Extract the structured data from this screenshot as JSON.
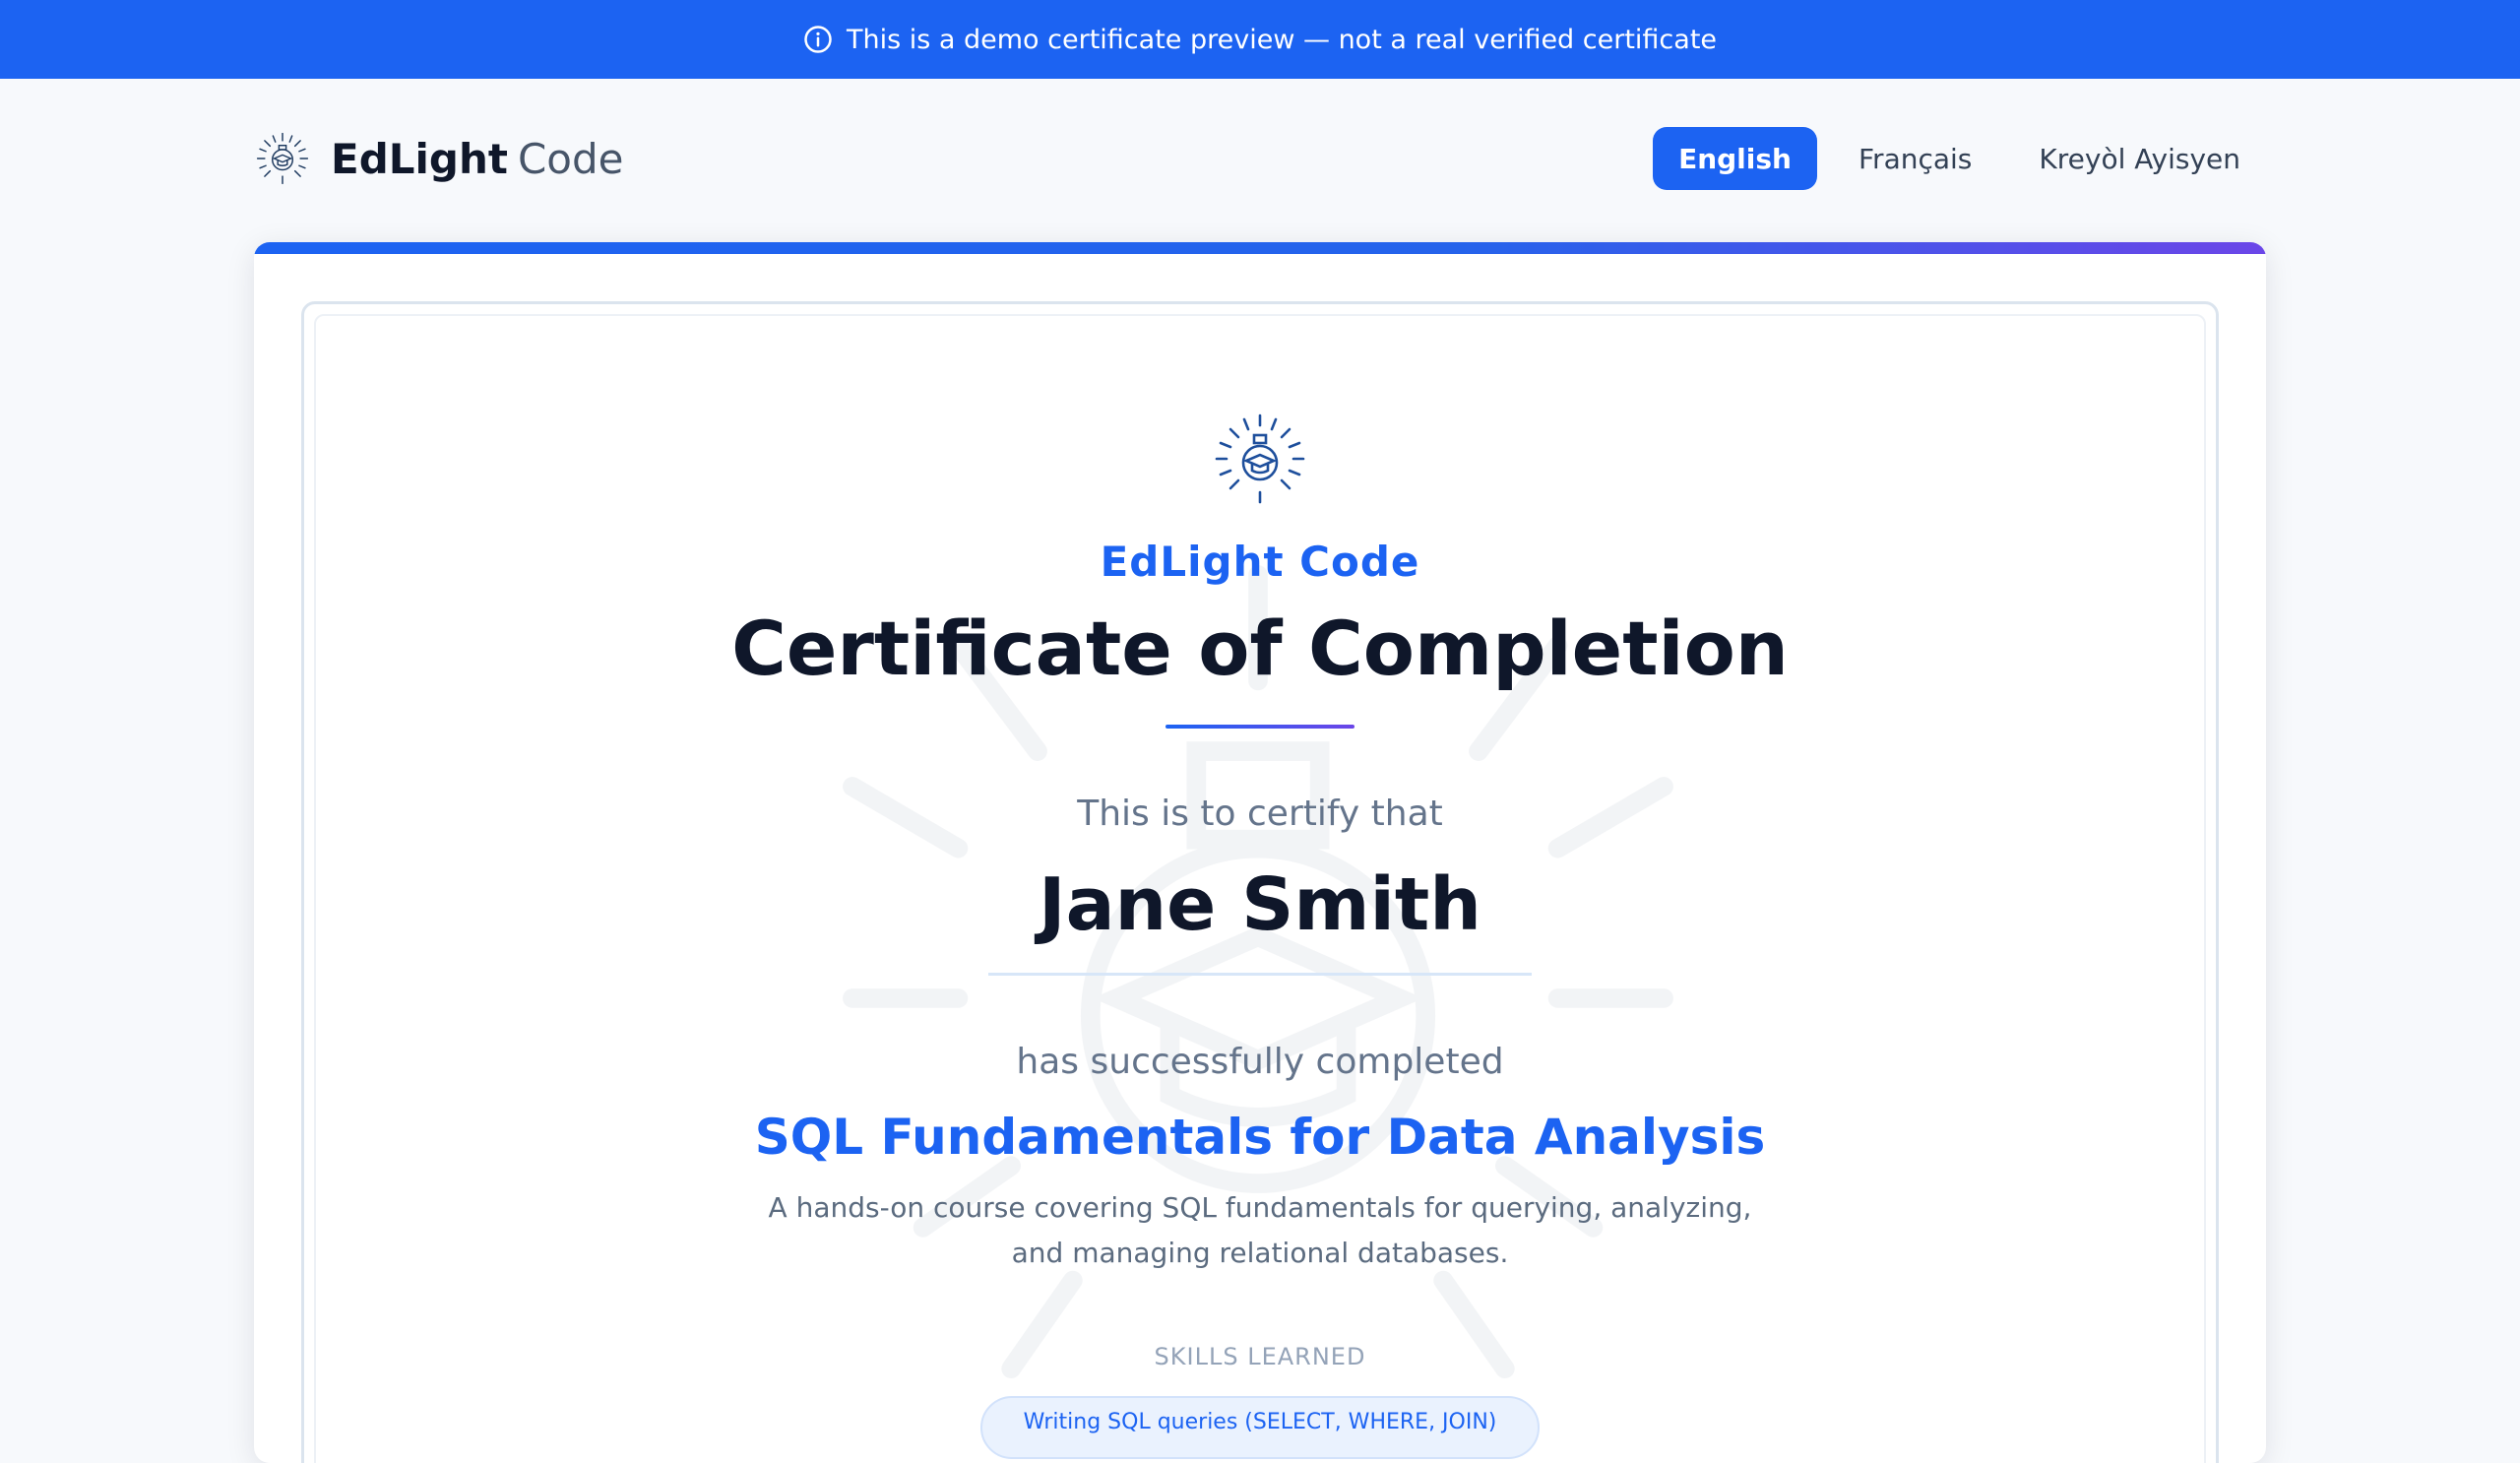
{
  "banner": {
    "text": "This is a demo certificate preview — not a real verified certificate",
    "icon": "info-icon"
  },
  "header": {
    "brand_strong": "EdLight",
    "brand_light": "Code",
    "logo_icon": "lightbulb-graduation-icon"
  },
  "languages": [
    {
      "label": "English",
      "active": true
    },
    {
      "label": "Français",
      "active": false
    },
    {
      "label": "Kreyòl Ayisyen",
      "active": false
    }
  ],
  "certificate": {
    "org": "EdLight Code",
    "title": "Certificate of Completion",
    "certify_text": "This is to certify that",
    "recipient": "Jane Smith",
    "completed_text": "has successfully completed",
    "course": "SQL Fundamentals for Data Analysis",
    "description": "A hands-on course covering SQL fundamentals for querying, analyzing, and managing relational databases.",
    "skills_label": "SKILLS LEARNED",
    "skills": [
      "Writing SQL queries (SELECT, WHERE, JOIN)"
    ]
  },
  "colors": {
    "primary": "#1c63f2",
    "accent_end": "#6b46e8",
    "background": "#f7f9fc"
  }
}
